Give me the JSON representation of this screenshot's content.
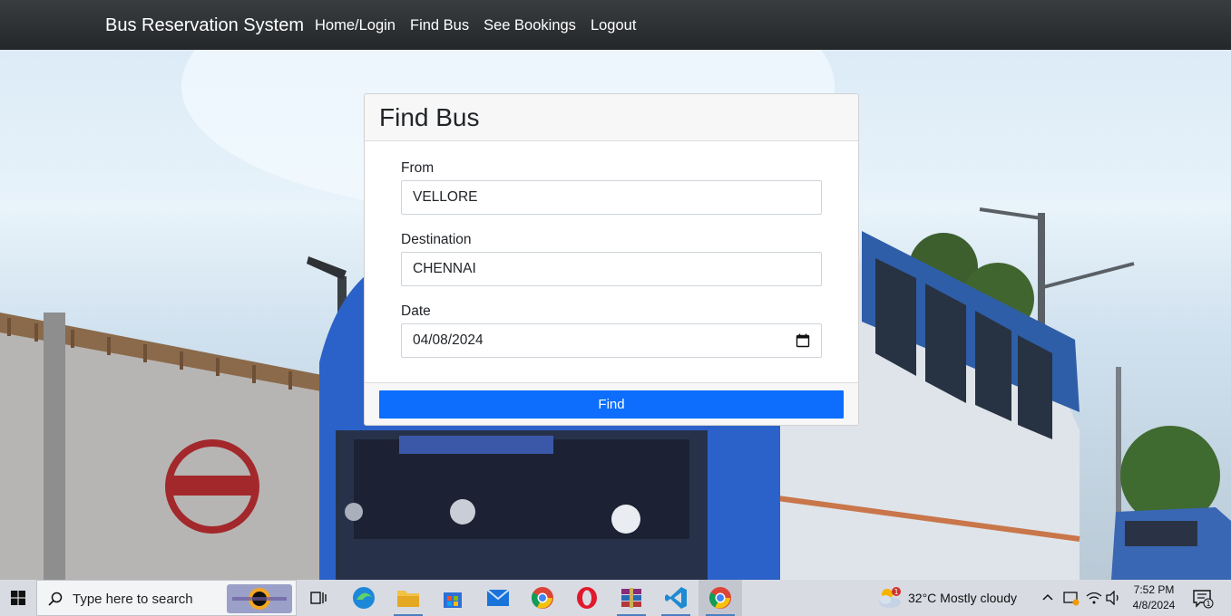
{
  "navbar": {
    "brand": "Bus Reservation System",
    "links": [
      "Home/Login",
      "Find Bus",
      "See Bookings",
      "Logout"
    ],
    "background": "#2b2e31"
  },
  "card": {
    "title": "Find Bus",
    "fields": [
      {
        "label": "From",
        "value": "VELLORE"
      },
      {
        "label": "Destination",
        "value": "CHENNAI"
      },
      {
        "label": "Date",
        "value": "04/08/2024"
      }
    ],
    "submit_label": "Find",
    "button_color": "#0d6efd"
  },
  "taskbar": {
    "search_placeholder": "Type here to search",
    "apps": [
      "task-view-icon",
      "edge-icon",
      "file-explorer-icon",
      "microsoft-store-icon",
      "mail-icon",
      "chrome-icon",
      "opera-icon",
      "winrar-icon",
      "vscode-icon",
      "chrome-icon"
    ],
    "weather": "32°C  Mostly cloudy",
    "weather_badge": "1",
    "time": "7:52 PM",
    "date": "4/8/2024",
    "notification_count": "1"
  }
}
